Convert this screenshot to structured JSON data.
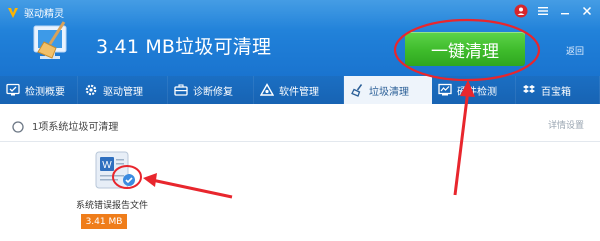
{
  "app": {
    "name": "驱动精灵"
  },
  "header": {
    "headline": "3.41 MB垃圾可清理",
    "primary_button": "一键清理",
    "back_label": "返回"
  },
  "tabs": [
    {
      "label": "检测概要",
      "icon": "monitor-check-icon"
    },
    {
      "label": "驱动管理",
      "icon": "gear-icon"
    },
    {
      "label": "诊断修复",
      "icon": "toolbox-icon"
    },
    {
      "label": "软件管理",
      "icon": "triangle-apps-icon"
    },
    {
      "label": "垃圾清理",
      "icon": "broom-icon",
      "active": true
    },
    {
      "label": "硬件检测",
      "icon": "chart-screen-icon"
    },
    {
      "label": "百宝箱",
      "icon": "dropbox-icon"
    }
  ],
  "summary": {
    "text": "1项系统垃圾可清理",
    "detail_link": "详情设置"
  },
  "items": [
    {
      "label": "系统错误报告文件",
      "size": "3.41 MB",
      "checked": true
    }
  ],
  "colors": {
    "header_blue": "#1f7ed7",
    "tab_blue": "#1763b3",
    "green_button": "#3ebb2b",
    "orange_badge": "#ef7d1a",
    "annotation_red": "#e8262d"
  }
}
